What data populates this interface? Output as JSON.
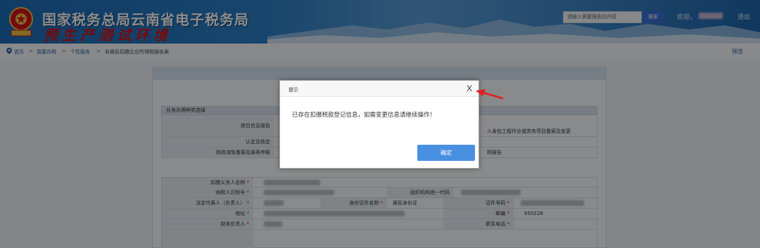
{
  "header": {
    "title_line1": "国家税务总局云南省电子税务局",
    "title_line2": "预生产测试环境",
    "search_placeholder": "请输入需要搜索的内容",
    "search_button": "搜索",
    "welcome": "欢迎，",
    "logout": "退出"
  },
  "breadcrumb": {
    "items": [
      "首页",
      "我要办税",
      "个性服务",
      "非居民扣缴企业所得税报告表"
    ],
    "separator": ">",
    "preview": "预览"
  },
  "form": {
    "section_title": "业务办理种类选择",
    "business_rows": [
      {
        "label": "综合信息报告",
        "text": "人发包工程作业或劳务项目备案及变更"
      },
      {
        "label": "认定及核定",
        "text": ""
      },
      {
        "label": "税收减免备案及报表申报",
        "text": "税报告"
      }
    ],
    "withholding_agent_label": "扣缴义务人名称",
    "taxpayer_id_label": "纳税人识别号",
    "org_code_label": "组织机构统一代码",
    "legal_rep_label": "法定代表人（负责人）",
    "id_type_label": "身份证件名称",
    "id_type_value": "居民身份证",
    "id_number_label": "证件号码",
    "address_label": "地址",
    "postcode_label": "邮编",
    "postcode_value": "650228",
    "finance_head_label": "财务负责人",
    "contact_phone_label": "联系电话"
  },
  "dialog": {
    "title": "提示",
    "close": "X",
    "message": "已存在扣缴税款登记信息，如需变更信息请继续操作！",
    "ok_button": "确定"
  },
  "colors": {
    "header_blue": "#2b7fc6",
    "title_red": "#d4151b",
    "button_blue": "#4a90e2",
    "arrow_red": "#e02020"
  }
}
